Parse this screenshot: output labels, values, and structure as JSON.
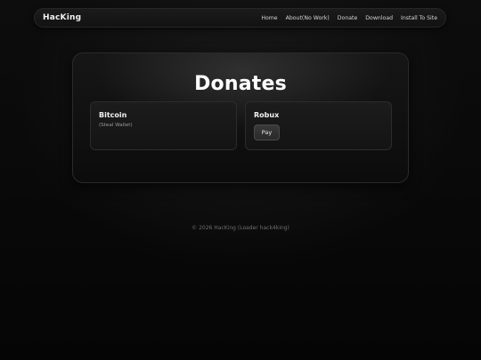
{
  "nav": {
    "brand": "HacKing",
    "links": [
      "Home",
      "About(No Work)",
      "Donate",
      "Download",
      "Install To Site"
    ]
  },
  "main": {
    "title": "Donates",
    "options": [
      {
        "title": "Bitcoin",
        "subtitle": "(Steal Wallet)"
      },
      {
        "title": "Robux",
        "button": "Pay"
      }
    ]
  },
  "footer": {
    "text": "© 2026 HacKing (Loader hack4king)"
  }
}
